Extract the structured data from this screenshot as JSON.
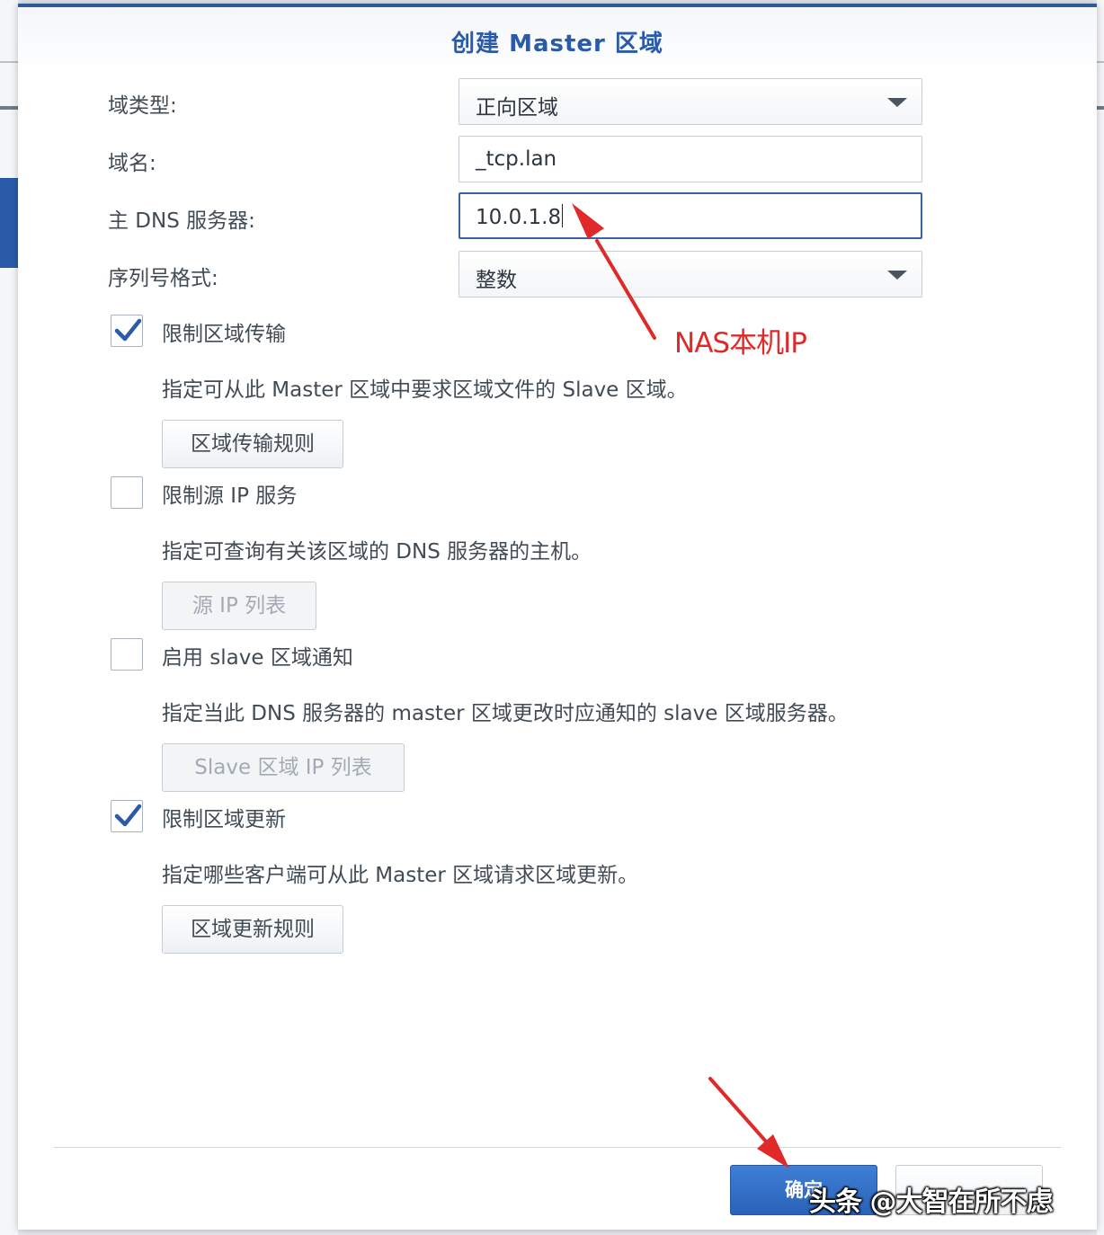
{
  "dialog": {
    "title": "创建 Master 区域"
  },
  "form": {
    "domain_type": {
      "label": "域类型:",
      "value": "正向区域"
    },
    "domain_name": {
      "label": "域名:",
      "value": "_tcp.lan"
    },
    "primary_dns": {
      "label": "主 DNS 服务器:",
      "value": "10.0.1.8"
    },
    "serial_format": {
      "label": "序列号格式:",
      "value": "整数"
    }
  },
  "options": [
    {
      "label": "限制区域传输",
      "checked": true,
      "description": "指定可从此 Master 区域中要求区域文件的 Slave 区域。",
      "button": "区域传输规则",
      "button_enabled": true
    },
    {
      "label": "限制源 IP 服务",
      "checked": false,
      "description": "指定可查询有关该区域的 DNS 服务器的主机。",
      "button": "源 IP 列表",
      "button_enabled": false
    },
    {
      "label": "启用 slave 区域通知",
      "checked": false,
      "description": "指定当此 DNS 服务器的 master 区域更改时应通知的 slave 区域服务器。",
      "button": "Slave 区域 IP 列表",
      "button_enabled": false
    },
    {
      "label": "限制区域更新",
      "checked": true,
      "description": "指定哪些客户端可从此 Master 区域请求区域更新。",
      "button": "区域更新规则",
      "button_enabled": true
    }
  ],
  "footer": {
    "ok_label": "确定",
    "cancel_label": ""
  },
  "annotations": {
    "nas_ip_note": "NAS本机IP",
    "arrow_color": "#e02a2a"
  },
  "watermark": "头条 @大智在所不虑",
  "colors": {
    "accent": "#2a5aa8",
    "title": "#2a5aa8",
    "annotation": "#e02a2a",
    "checkmark": "#2a5aa8"
  },
  "icons": {
    "select_arrow": "chevron-down-icon",
    "checkbox_checked": "checkmark-icon"
  }
}
